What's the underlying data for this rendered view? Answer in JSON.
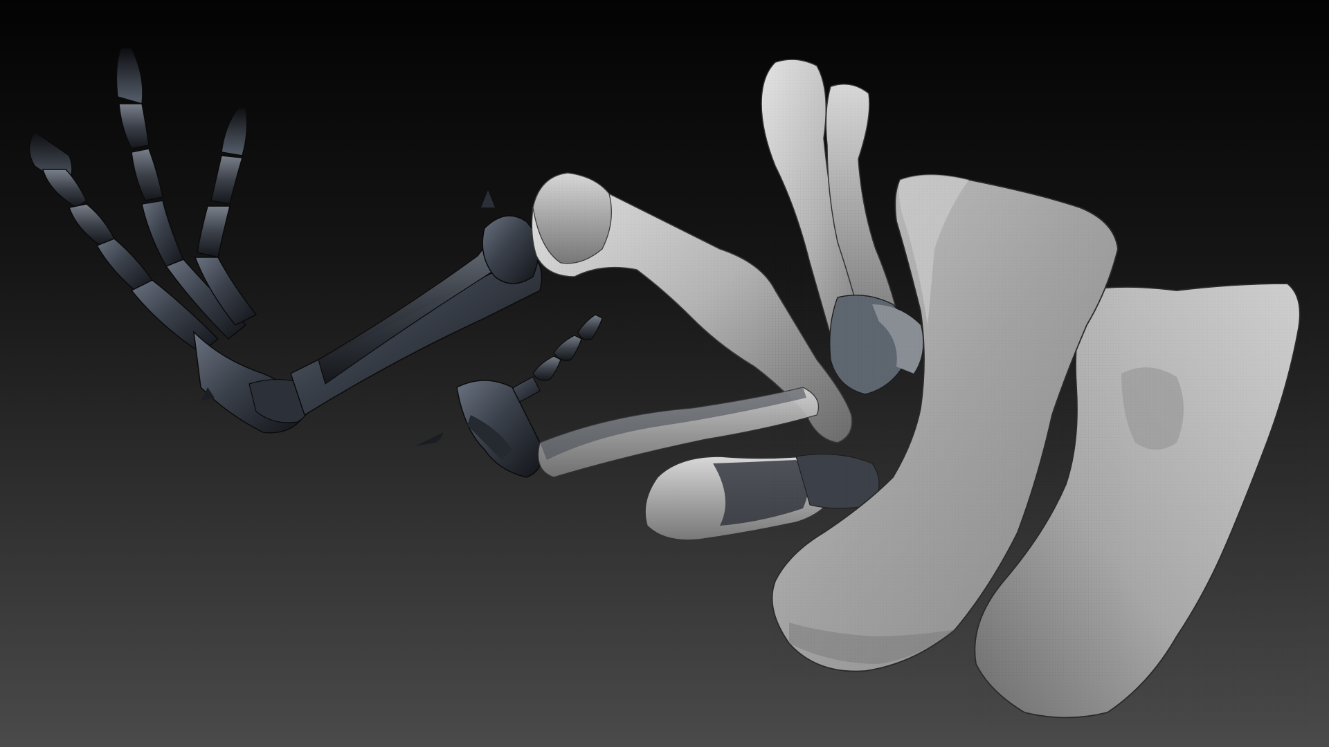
{
  "scene": {
    "subject": "skeletal-forelimb-render",
    "background_top": "#030303",
    "background_bottom": "#4a4a4a",
    "dark_bone_light": "#6a7280",
    "dark_bone_mid": "#2e333c",
    "dark_bone_shadow": "#101216",
    "light_bone_light": "#dcdcdc",
    "light_bone_mid": "#a8a8a8",
    "light_bone_shadow": "#5a5a5a",
    "claw_tip": "#111318"
  }
}
